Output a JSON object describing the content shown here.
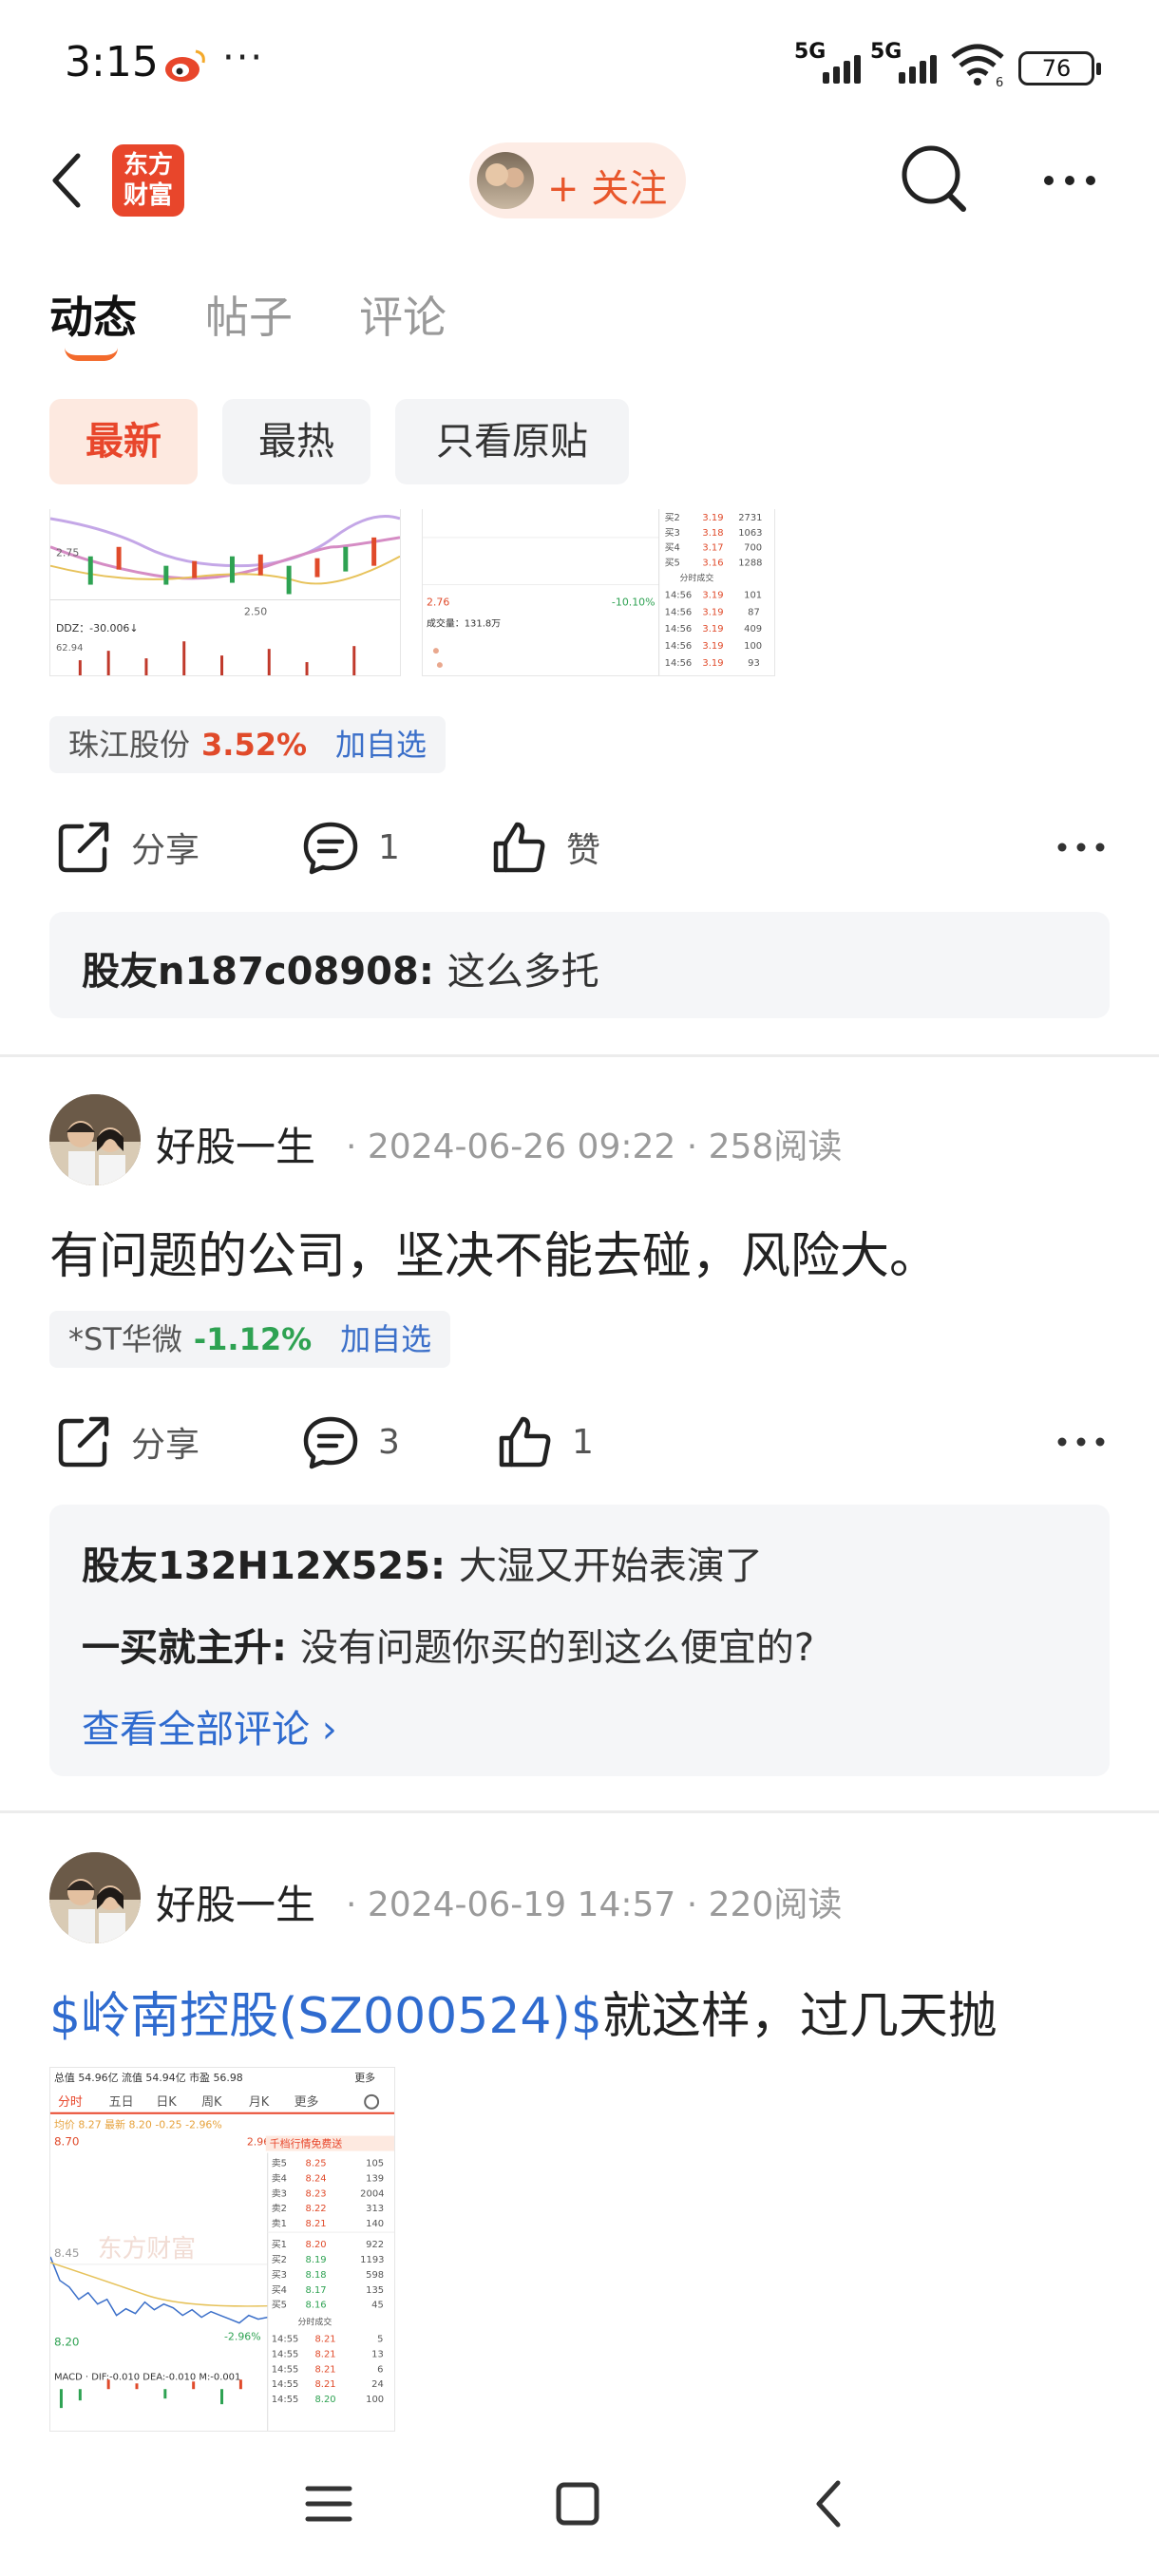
{
  "status_bar": {
    "time": "3:15",
    "dots": "···",
    "network_1": "5G",
    "network_2": "5G",
    "wifi_badge": "6",
    "battery": "76"
  },
  "header": {
    "logo_line1": "东方",
    "logo_line2": "财富",
    "follow_label": "+ 关注"
  },
  "tabs": [
    {
      "label": "动态",
      "active": true
    },
    {
      "label": "帖子",
      "active": false
    },
    {
      "label": "评论",
      "active": false
    }
  ],
  "filters": [
    {
      "label": "最新",
      "active": true
    },
    {
      "label": "最热",
      "active": false
    },
    {
      "label": "只看原贴",
      "active": false
    }
  ],
  "post1": {
    "chart_left": {
      "label_275": "2.75",
      "label_250": "2.50",
      "label_ddz": "DDZ：-30.006↓",
      "label_6294": "62.94"
    },
    "chart_right": {
      "price_276": "2.76",
      "volume": "成交量：131.8万",
      "pct": "-10.10%",
      "section": "分时成交",
      "asks": [
        {
          "name": "买2",
          "price": "3.19",
          "vol": "2731"
        },
        {
          "name": "买3",
          "price": "3.18",
          "vol": "1063"
        },
        {
          "name": "买4",
          "price": "3.17",
          "vol": "700"
        },
        {
          "name": "买5",
          "price": "3.16",
          "vol": "1288"
        }
      ],
      "trades": [
        {
          "time": "14:56",
          "price": "3.19",
          "vol": "101"
        },
        {
          "time": "14:56",
          "price": "3.19",
          "vol": "87"
        },
        {
          "time": "14:56",
          "price": "3.19",
          "vol": "409"
        },
        {
          "time": "14:56",
          "price": "3.19",
          "vol": "100"
        },
        {
          "time": "14:56",
          "price": "3.19",
          "vol": "93"
        }
      ]
    },
    "stock": {
      "name": "珠江股份",
      "pct": "3.52%",
      "add": "加自选"
    },
    "actions": {
      "share": "分享",
      "comment_count": "1",
      "like": "赞"
    },
    "comments": [
      {
        "user": "股友n187c08908",
        "sep": ": ",
        "text": "这么多托"
      }
    ]
  },
  "post2": {
    "author": "好股一生",
    "meta": "· 2024-06-26 09:22 · 258阅读",
    "text": "有问题的公司，坚决不能去碰，风险大。",
    "stock": {
      "name": "*ST华微",
      "pct": "-1.12%",
      "add": "加自选"
    },
    "actions": {
      "share": "分享",
      "comment_count": "3",
      "like_count": "1"
    },
    "comments": [
      {
        "user": "股友132H12X525",
        "sep": ": ",
        "text": "大湿又开始表演了"
      },
      {
        "user": "一买就主升",
        "sep": ": ",
        "text": "没有问题你买的到这么便宜的?"
      }
    ],
    "view_all": "查看全部评论 ›"
  },
  "post3": {
    "author": "好股一生",
    "meta": "· 2024-06-19 14:57 · 220阅读",
    "stock_link": "$岭南控股(SZ000524)$",
    "text_rest": "就这样，过几天抛",
    "chart": {
      "header": "总值 54.96亿 流值 54.94亿 市盈 56.98",
      "more": "更多",
      "tabs": [
        "分时",
        "五日",
        "日K",
        "周K",
        "月K",
        "更多"
      ],
      "avg_line": "均价 8.27 最新 8.20 -0.25 -2.96%",
      "high": "8.70",
      "mid": "8.45",
      "low": "8.20",
      "pct_top": "2.96%",
      "pct_low": "-2.96%",
      "promo": "千档行情免费送",
      "watermark": "东方财富",
      "macd": "MACD · DIF:-0.010 DEA:-0.010 M:-0.001",
      "book": [
        {
          "name": "卖5",
          "price": "8.25",
          "vol": "105"
        },
        {
          "name": "卖4",
          "price": "8.24",
          "vol": "139"
        },
        {
          "name": "卖3",
          "price": "8.23",
          "vol": "2004"
        },
        {
          "name": "卖2",
          "price": "8.22",
          "vol": "313"
        },
        {
          "name": "卖1",
          "price": "8.21",
          "vol": "140"
        },
        {
          "name": "买1",
          "price": "8.20",
          "vol": "922"
        },
        {
          "name": "买2",
          "price": "8.19",
          "vol": "1193"
        },
        {
          "name": "买3",
          "price": "8.18",
          "vol": "598"
        },
        {
          "name": "买4",
          "price": "8.17",
          "vol": "135"
        },
        {
          "name": "买5",
          "price": "8.16",
          "vol": "45"
        }
      ],
      "section": "分时成交",
      "trades": [
        {
          "time": "14:55",
          "price": "8.21",
          "vol": "5"
        },
        {
          "time": "14:55",
          "price": "8.21",
          "vol": "13"
        },
        {
          "time": "14:55",
          "price": "8.21",
          "vol": "6"
        },
        {
          "time": "14:55",
          "price": "8.21",
          "vol": "24"
        },
        {
          "time": "14:55",
          "price": "8.20",
          "vol": "100"
        }
      ]
    }
  },
  "colors": {
    "accent": "#e8462b",
    "up": "#e04a2a",
    "down": "#2ea252",
    "link": "#2f6bcf"
  }
}
